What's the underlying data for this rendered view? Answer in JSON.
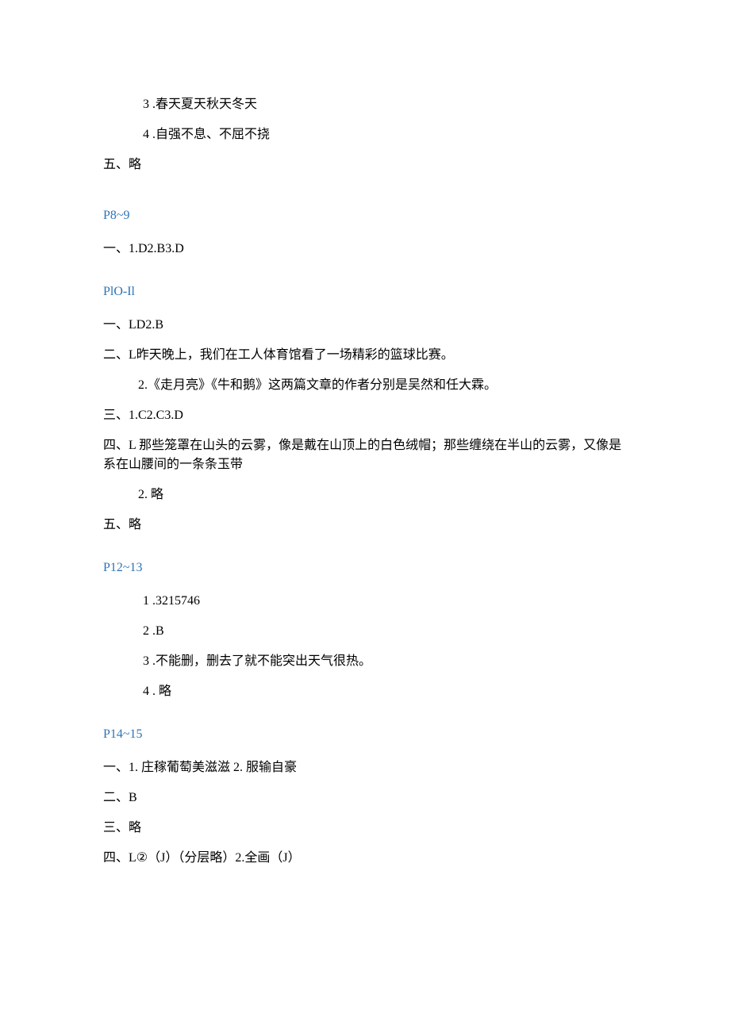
{
  "top": {
    "line1_num": "3",
    "line1_txt": " .春天夏天秋天冬天",
    "line2_num": "4",
    "line2_txt": " .自强不息、不屈不挠",
    "line3": "五、略"
  },
  "sec1": {
    "heading": "P8~9",
    "line1": "一、1.D2.B3.D"
  },
  "sec2": {
    "heading": "PlO-Il",
    "line1": "一、LD2.B",
    "line2": "二、L昨天晚上，我们在工人体育馆看了一场精彩的篮球比赛。",
    "line3": "2.《走月亮》《牛和鹅》这两篇文章的作者分别是吴然和任大霖。",
    "line4": "三、1.C2.C3.D",
    "line5": "四、L 那些笼罩在山头的云雾，像是戴在山顶上的白色绒帽；那些缠绕在半山的云雾，又像是系在山腰间的一条条玉带",
    "line6": "2. 略",
    "line7": "五、略"
  },
  "sec3": {
    "heading": "P12~13",
    "line1_num": "1",
    "line1_txt": " .3215746",
    "line2_num": "2",
    "line2_txt": "  .B",
    "line3_num": "3",
    "line3_txt": " .不能删，删去了就不能突出天气很热。",
    "line4_num": "4",
    "line4_txt": "  . 略"
  },
  "sec4": {
    "heading": "P14~15",
    "line1": "一、1. 庄稼葡萄美滋滋 2. 服输自豪",
    "line2": "二、B",
    "line3": "三、略",
    "line4": "四、L②（J）（分层略）2.全画（J）"
  }
}
